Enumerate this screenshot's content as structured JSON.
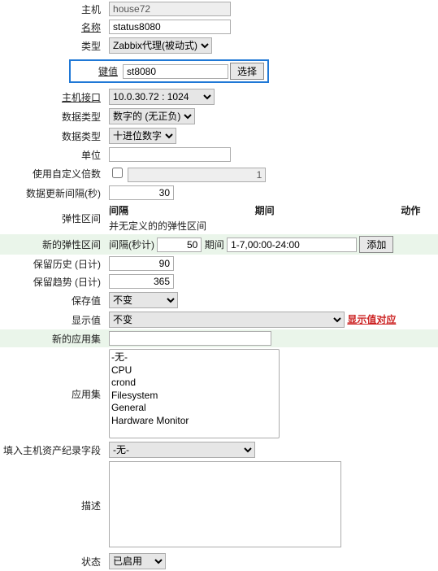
{
  "labels": {
    "host": "主机",
    "name": "名称",
    "type": "类型",
    "key": "键值",
    "interface": "主机接口",
    "info_type": "数据类型",
    "data_type": "数据类型",
    "units": "单位",
    "custom_mult": "使用自定义倍数",
    "update_interval": "数据更新间隔(秒)",
    "flex_intervals": "弹性区间",
    "new_flex": "新的弹性区间",
    "history": "保留历史 (日计)",
    "trends": "保留趋势 (日计)",
    "store_value": "保存值",
    "show_value": "显示值",
    "new_app": "新的应用集",
    "applications": "应用集",
    "inventory": "填入主机资产纪录字段",
    "description": "描述",
    "status": "状态"
  },
  "flex_cols": {
    "interval": "间隔",
    "period": "期间",
    "action": "动作"
  },
  "flex_empty": "并无定义的的弹性区间",
  "new_flex_label": "间隔(秒计)",
  "new_flex_period_label": "期间",
  "show_value_link": "显示值对应",
  "buttons": {
    "select": "选择",
    "add": "添加"
  },
  "values": {
    "host": "house72",
    "name": "status8080",
    "type": "Zabbix代理(被动式)",
    "key": "st8080",
    "interface": "10.0.30.72 : 1024",
    "info_type": "数字的 (无正负)",
    "data_type": "十进位数字",
    "units": "",
    "custom_mult_checked": false,
    "custom_mult_value": "1",
    "update_interval": "30",
    "new_flex_interval": "50",
    "new_flex_period": "1-7,00:00-24:00",
    "history": "90",
    "trends": "365",
    "store_value": "不变",
    "show_value": "不变",
    "new_app": "",
    "inventory": "-无-",
    "description": "",
    "status": "已启用"
  },
  "apps": [
    "-无-",
    "CPU",
    "crond",
    "Filesystem",
    "General",
    "Hardware Monitor"
  ]
}
